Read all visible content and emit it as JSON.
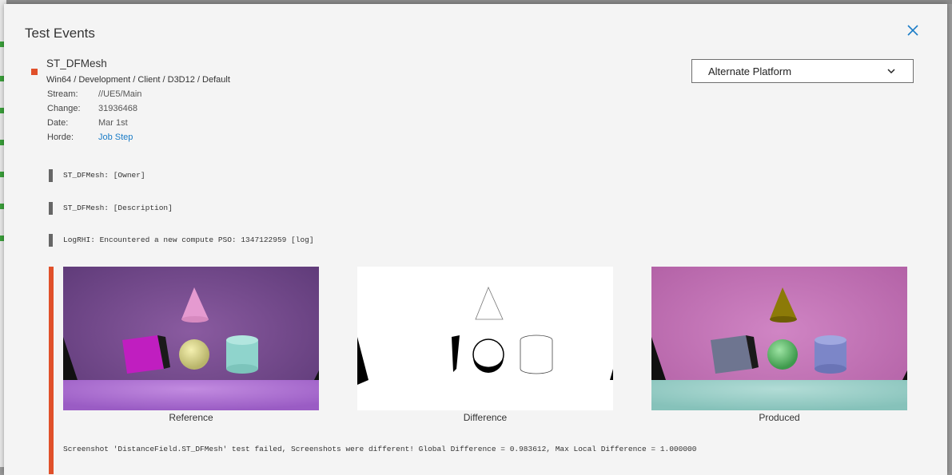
{
  "dialog": {
    "title": "Test Events"
  },
  "test": {
    "name": "ST_DFMesh",
    "meta": "Win64 / Development / Client / D3D12 / Default",
    "status_color": "#e0502a",
    "info": {
      "stream_label": "Stream:",
      "stream_value": "//UE5/Main",
      "change_label": "Change:",
      "change_value": "31936468",
      "date_label": "Date:",
      "date_value": "Mar 1st",
      "horde_label": "Horde:",
      "horde_value": "Job Step"
    }
  },
  "platform_dropdown": {
    "selected": "Alternate Platform"
  },
  "log": {
    "lines": [
      "ST_DFMesh: [Owner]",
      "ST_DFMesh: [Description]",
      "LogRHI: Encountered a new compute PSO: 1347122959 [log]"
    ],
    "error_color": "#e0502a"
  },
  "screenshots": {
    "reference_label": "Reference",
    "difference_label": "Difference",
    "produced_label": "Produced"
  },
  "failure_message": "Screenshot 'DistanceField.ST_DFMesh' test failed, Screenshots were different!  Global Difference = 0.983612, Max Local Difference = 1.000000"
}
